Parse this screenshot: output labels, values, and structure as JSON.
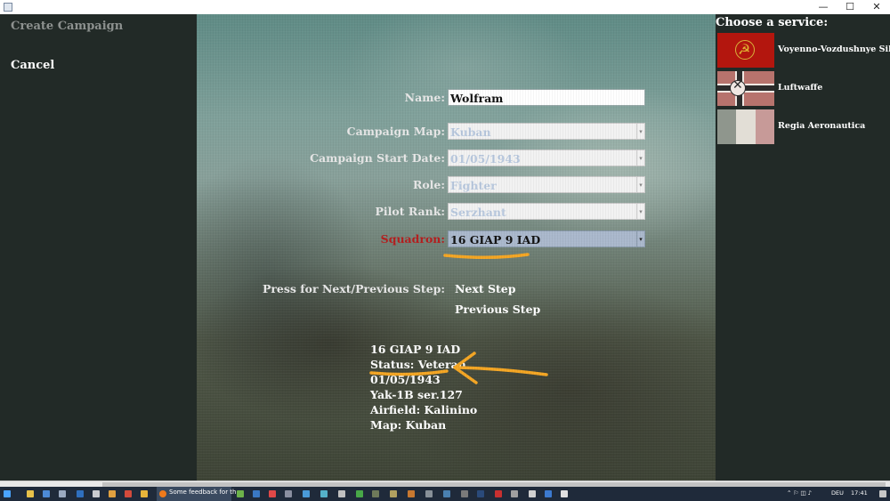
{
  "window": {
    "minimize": "—",
    "maximize": "☐",
    "close": "✕"
  },
  "left": {
    "create_campaign": "Create Campaign",
    "cancel": "Cancel"
  },
  "form": {
    "name_label": "Name:",
    "name_value": "Wolfram",
    "map_label": "Campaign Map:",
    "map_value": "Kuban",
    "date_label": "Campaign Start Date:",
    "date_value": "01/05/1943",
    "role_label": "Role:",
    "role_value": "Fighter",
    "rank_label": "Pilot Rank:",
    "rank_value": "Serzhant",
    "squadron_label": "Squadron:",
    "squadron_value": "16 GIAP 9 IAD",
    "dropdown_glyph": "▾"
  },
  "nav": {
    "prompt": "Press for Next/Previous Step:",
    "next": "Next Step",
    "previous": "Previous Step"
  },
  "summary": [
    "16 GIAP 9 IAD",
    "Status: Veteran",
    "01/05/1943",
    "Yak-1B ser.127",
    "Airfield: Kalinino",
    "Map: Kuban"
  ],
  "services": {
    "header": "Choose a service:",
    "items": [
      {
        "label": "Voyenno-Vozdushnye Sily"
      },
      {
        "label": "Luftwaffe"
      },
      {
        "label": "Regia Aeronautica"
      }
    ]
  },
  "annotation_color": "#f5a623",
  "taskbar": {
    "firefox_label": "Some feedback for th...",
    "language": "DEU",
    "time": "17:41"
  }
}
